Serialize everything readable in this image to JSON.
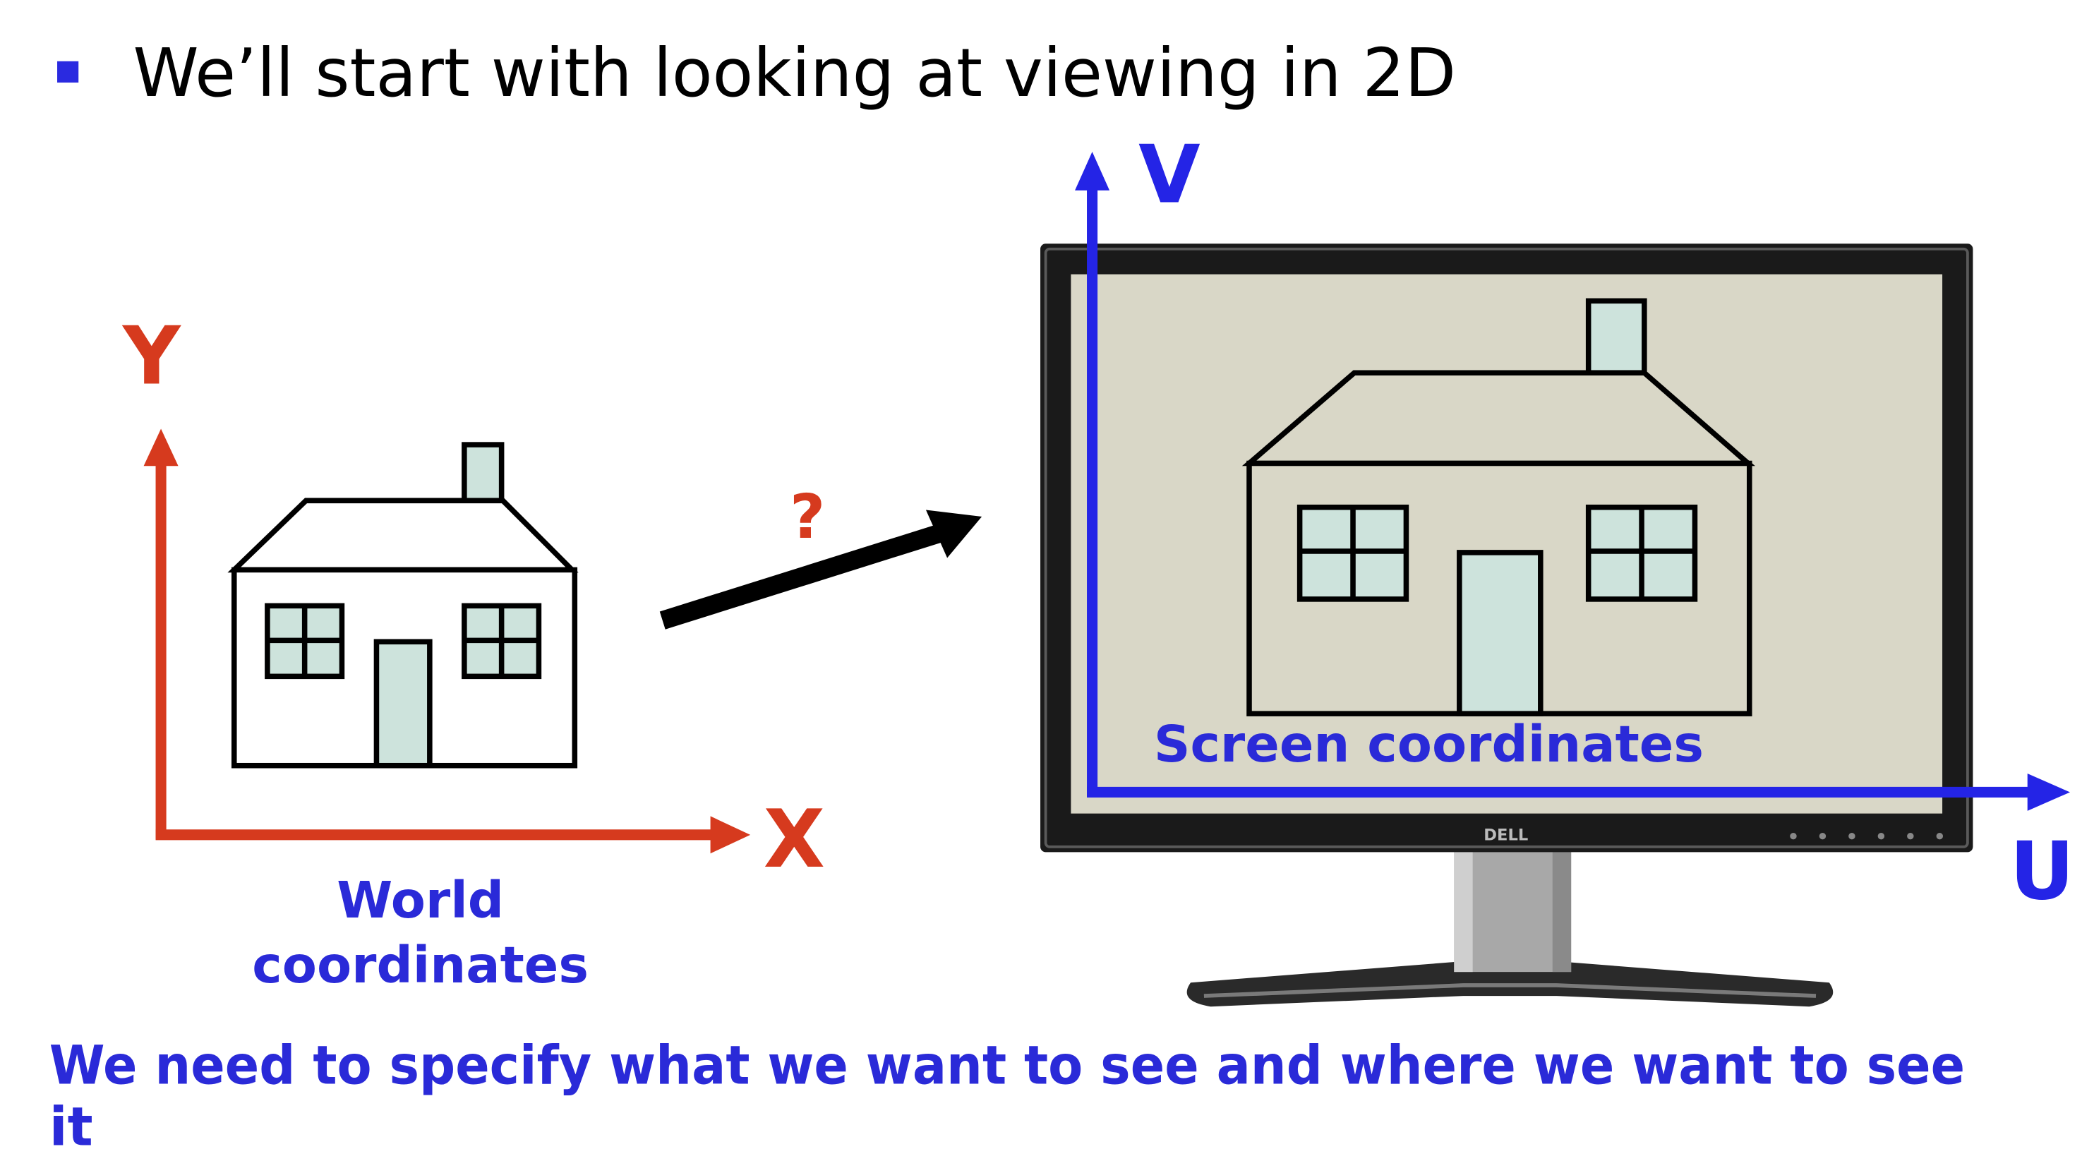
{
  "slide": {
    "bullet_text": "We’ll start with looking at viewing in 2D",
    "footer_text_line1": "We need to specify what we want to see and where we want to see",
    "footer_text_line2": "it"
  },
  "world": {
    "y_axis_label": "Y",
    "x_axis_label": "X",
    "caption_line1": "World",
    "caption_line2": "coordinates"
  },
  "transform": {
    "question_mark": "?"
  },
  "screen": {
    "v_axis_label": "V",
    "u_axis_label": "U",
    "caption": "Screen coordinates",
    "monitor_brand": "DELL"
  },
  "colors": {
    "bullet": "#2a2ae0",
    "world_axis": "#d63a1e",
    "screen_axis": "#2424e6",
    "caption_blue": "#2a2ad8",
    "house_fill": "#cde3dc",
    "screen_bg": "#d9d7c7",
    "outline": "#000000"
  }
}
